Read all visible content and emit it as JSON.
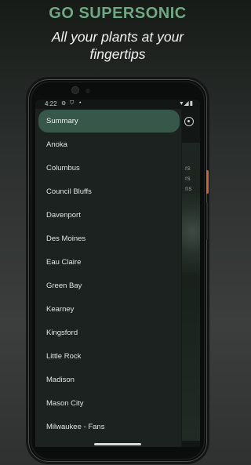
{
  "promo": {
    "headline": "GO SUPERSONIC",
    "tagline": "All your plants at your fingertips"
  },
  "statusbar": {
    "time": "4:22",
    "left_icons": [
      "settings-gear-icon",
      "shield-icon",
      "notification-dot-icon"
    ],
    "right_icons": [
      "wifi-icon",
      "signal-icon",
      "battery-icon"
    ]
  },
  "background_screen": {
    "settings_icon": "settings-icon",
    "visible_text_fragments": [
      "rs",
      "rs",
      "ns"
    ]
  },
  "drawer": {
    "items": [
      {
        "label": "Summary",
        "active": true
      },
      {
        "label": "Anoka",
        "active": false
      },
      {
        "label": "Columbus",
        "active": false
      },
      {
        "label": "Council Bluffs",
        "active": false
      },
      {
        "label": "Davenport",
        "active": false
      },
      {
        "label": "Des Moines",
        "active": false
      },
      {
        "label": "Eau Claire",
        "active": false
      },
      {
        "label": "Green Bay",
        "active": false
      },
      {
        "label": "Kearney",
        "active": false
      },
      {
        "label": "Kingsford",
        "active": false
      },
      {
        "label": "Little Rock",
        "active": false
      },
      {
        "label": "Madison",
        "active": false
      },
      {
        "label": "Mason City",
        "active": false
      },
      {
        "label": "Milwaukee - Fans",
        "active": false
      }
    ]
  },
  "colors": {
    "accent_green": "#6fa882",
    "active_item_bg": "#37574a",
    "drawer_bg": "#1c2220",
    "power_button": "#c8643c"
  }
}
